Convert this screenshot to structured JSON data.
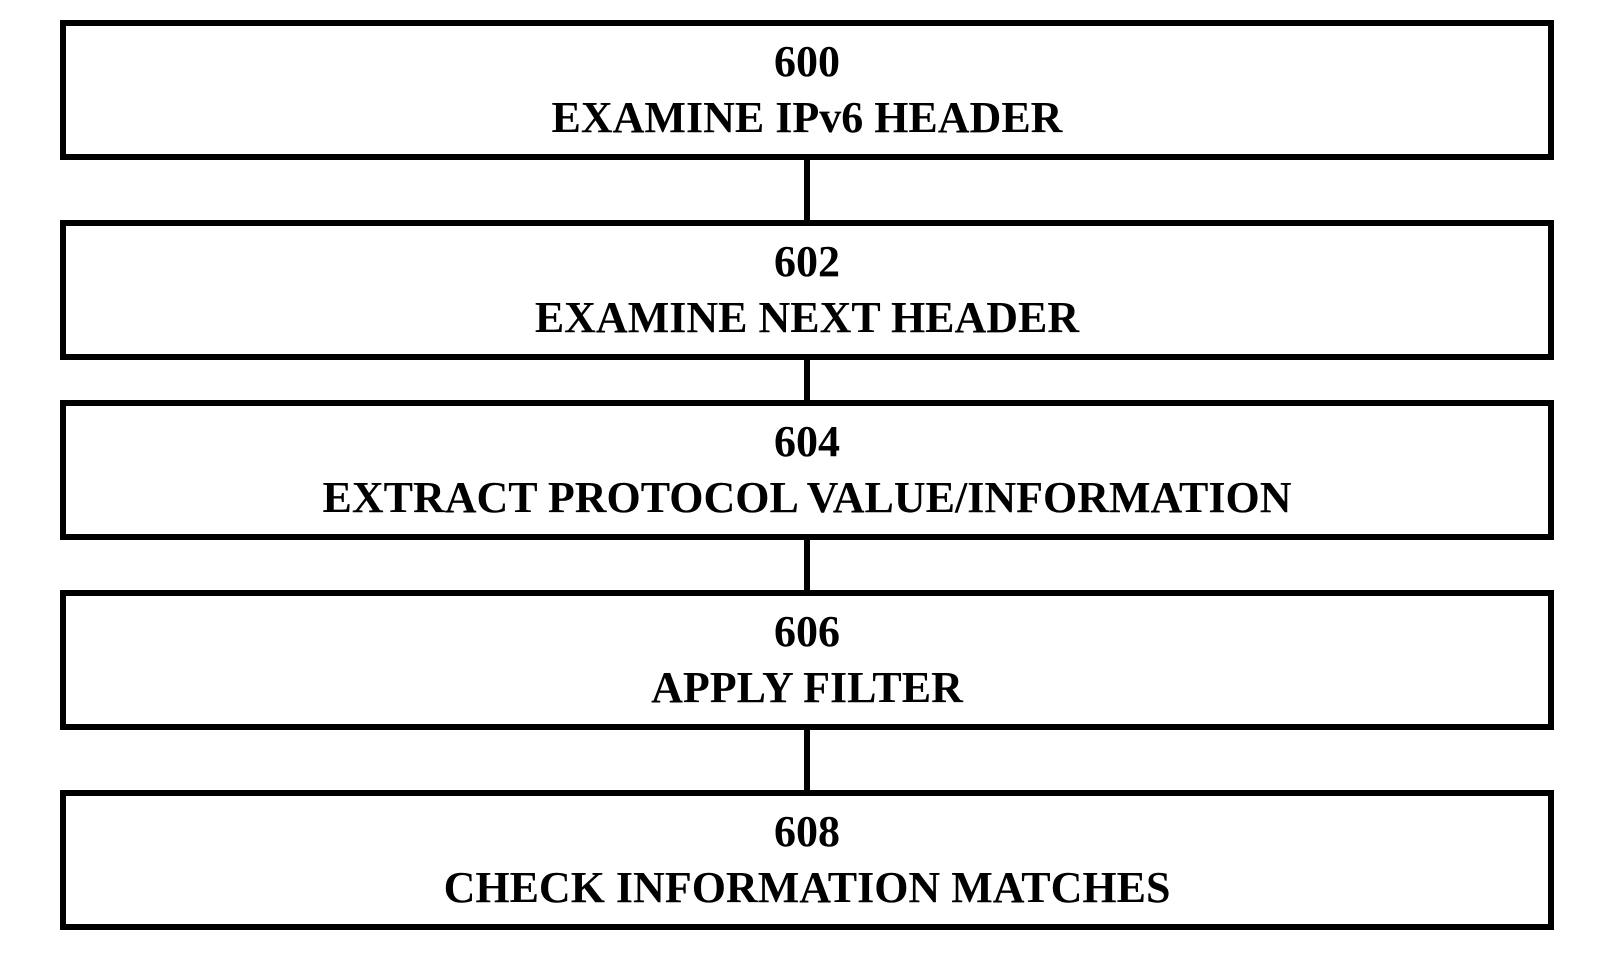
{
  "steps": [
    {
      "num": "600",
      "text": "EXAMINE IPv6 HEADER"
    },
    {
      "num": "602",
      "text": "EXAMINE NEXT HEADER"
    },
    {
      "num": "604",
      "text": "EXTRACT PROTOCOL VALUE/INFORMATION"
    },
    {
      "num": "606",
      "text": "APPLY FILTER"
    },
    {
      "num": "608",
      "text": "CHECK INFORMATION MATCHES"
    }
  ]
}
